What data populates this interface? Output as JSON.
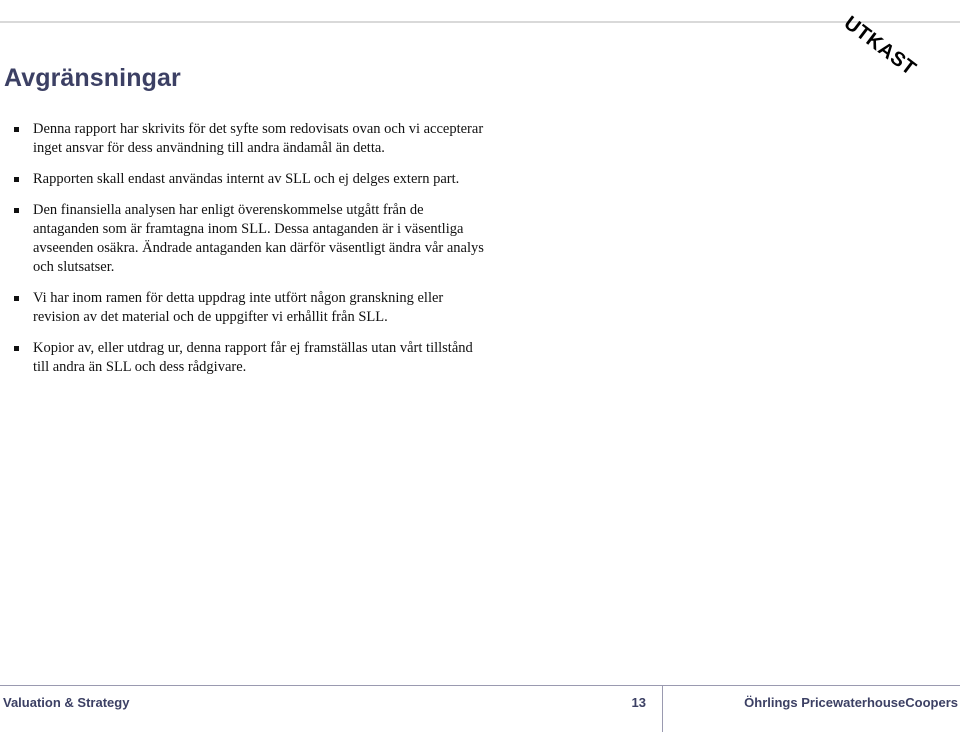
{
  "document": {
    "watermark": "UTKAST",
    "title": "Avgränsningar",
    "bullets": [
      {
        "text": "Denna rapport har skrivits för det syfte som redovisats ovan och vi accepterar inget ansvar för dess användning till andra ändamål än detta."
      },
      {
        "text": "Rapporten skall endast användas internt av SLL och ej delges extern part."
      },
      {
        "text": "Den finansiella analysen har enligt överenskommelse utgått från de antaganden som är framtagna inom SLL. Dessa antaganden är i väsentliga avseenden osäkra. Ändrade antaganden kan därför väsentligt ändra vår analys och slutsatser."
      },
      {
        "text": "Vi har inom ramen för detta uppdrag inte utfört någon granskning eller revision av det material och de uppgifter vi erhållit från SLL."
      },
      {
        "text": "Kopior av, eller utdrag ur, denna rapport får ej framställas utan vårt tillstånd till andra än SLL och dess rådgivare."
      }
    ],
    "footer": {
      "left": "Valuation & Strategy",
      "page_number": "13",
      "right": "Öhrlings PricewaterhouseCoopers"
    },
    "colors": {
      "heading": "#3c4064",
      "body_text": "#111111",
      "rule": "#d9d9d9",
      "footer_rule": "#9a9ab0",
      "watermark": "#000000"
    }
  }
}
